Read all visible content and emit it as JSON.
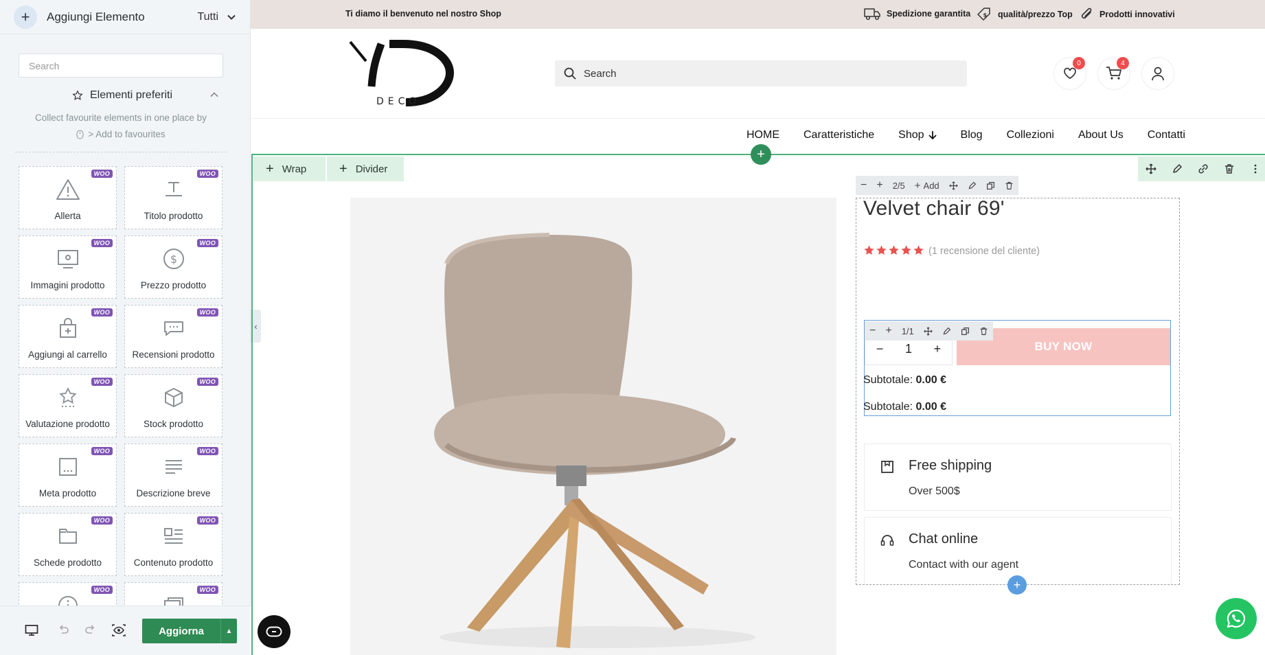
{
  "panel": {
    "title": "Aggiungi Elemento",
    "filter": "Tutti",
    "search_placeholder": "Search",
    "favourites": {
      "title": "Elementi preferiti",
      "desc_line1": "Collect favourite elements in one place by",
      "desc_line2": "> Add to favourites"
    },
    "badge": "WOO",
    "tiles": [
      {
        "label": "Allerta",
        "icon": "alert-triangle-icon"
      },
      {
        "label": "Titolo prodotto",
        "icon": "text-title-icon"
      },
      {
        "label": "Immagini prodotto",
        "icon": "product-images-icon"
      },
      {
        "label": "Prezzo prodotto",
        "icon": "dollar-circle-icon"
      },
      {
        "label": "Aggiungi al carrello",
        "icon": "shopping-bag-icon"
      },
      {
        "label": "Recensioni prodotto",
        "icon": "chat-bubble-icon"
      },
      {
        "label": "Valutazione prodotto",
        "icon": "star-rating-icon"
      },
      {
        "label": "Stock prodotto",
        "icon": "box-icon"
      },
      {
        "label": "Meta prodotto",
        "icon": "meta-box-icon"
      },
      {
        "label": "Descrizione breve",
        "icon": "text-lines-icon"
      },
      {
        "label": "Schede prodotto",
        "icon": "folder-tabs-icon"
      },
      {
        "label": "Contenuto prodotto",
        "icon": "content-icon"
      },
      {
        "label": "",
        "icon": "info-circle-icon"
      },
      {
        "label": "",
        "icon": "cards-icon"
      }
    ],
    "update_button": "Aggiorna"
  },
  "topbar": {
    "welcome": "Ti diamo il benvenuto nel nostro Shop",
    "perks": [
      {
        "label": "Spedizione garantita",
        "icon": "truck-icon"
      },
      {
        "label": "qualità/prezzo Top",
        "icon": "price-tag-icon"
      },
      {
        "label": "Prodotti innovativi",
        "icon": "paperclip-icon"
      }
    ]
  },
  "header": {
    "logo_text": "DECO",
    "search_placeholder": "Search",
    "wishlist_count": "0",
    "cart_count": "4"
  },
  "menu": [
    "HOME",
    "Caratteristiche",
    "Shop",
    "Blog",
    "Collezioni",
    "About Us",
    "Contatti"
  ],
  "editor": {
    "wrap_label": "Wrap",
    "divider_label": "Divider",
    "column_toolbar": {
      "counter": "2/5",
      "add_label": "Add"
    },
    "inner_toolbar": {
      "counter": "1/1"
    }
  },
  "product": {
    "title": "Velvet chair 69'",
    "rating": 5,
    "reviews": "(1 recensione del cliente)",
    "quantity": "1",
    "buy_now": "BUY NOW",
    "subtotal_label": "Subtotale:",
    "subtotal_value": "0.00 €"
  },
  "info_cards": [
    {
      "title": "Free shipping",
      "desc": "Over 500$",
      "icon": "shipping-icon"
    },
    {
      "title": "Chat online",
      "desc": "Contact with our agent",
      "icon": "headset-icon"
    }
  ],
  "colors": {
    "accent_green": "#2e8b53",
    "buy_now_bg": "#f7c3c1",
    "woo_purple": "#7f54b3",
    "badge_red": "#ef4c4c",
    "star_red": "#e8534f"
  }
}
